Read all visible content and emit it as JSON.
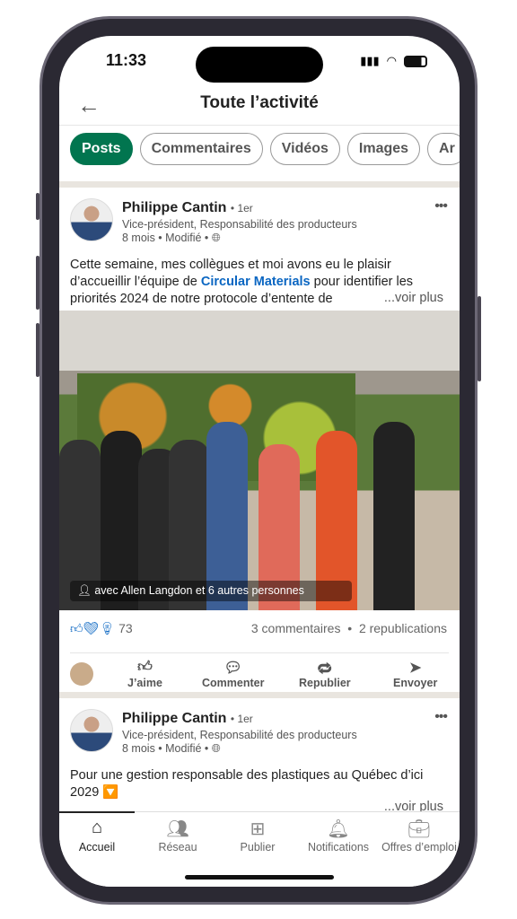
{
  "status": {
    "time": "11:33"
  },
  "header": {
    "title": "Toute l’activité",
    "back_icon": "arrow-left-icon"
  },
  "filters": [
    {
      "label": "Posts",
      "active": true
    },
    {
      "label": "Commentaires"
    },
    {
      "label": "Vidéos"
    },
    {
      "label": "Images"
    },
    {
      "label": "Ar"
    }
  ],
  "accent": "#01754f",
  "posts": [
    {
      "author": "Philippe Cantin",
      "degree": "• 1er",
      "headline": "Vice-président, Responsabilité des producteurs",
      "meta": "8 mois • Modifié •",
      "text_before": "Cette semaine, mes collègues et moi avons eu le plaisir d’accueillir l’équipe de ",
      "link": "Circular Materials",
      "text_after": " pour identifier les priorités 2024 de notre protocole d’entente de",
      "see_more": "...voir plus",
      "photo_tag": "avec Allen Langdon et 6 autres personnes",
      "reactions": "73",
      "comments": "3 commentaires",
      "reposts": "2 republications"
    },
    {
      "author": "Philippe Cantin",
      "degree": "• 1er",
      "headline": "Vice-président, Responsabilité des producteurs",
      "meta": "8 mois • Modifié •",
      "text": "Pour une gestion responsable des plastiques au Québec d’ici 2029 🔽",
      "see_more": "...voir plus"
    }
  ],
  "actions": [
    "J’aime",
    "Commenter",
    "Republier",
    "Envoyer"
  ],
  "tabs": [
    {
      "label": "Accueil",
      "active": true
    },
    {
      "label": "Réseau"
    },
    {
      "label": "Publier"
    },
    {
      "label": "Notifications"
    },
    {
      "label": "Offres d’emploi"
    }
  ]
}
